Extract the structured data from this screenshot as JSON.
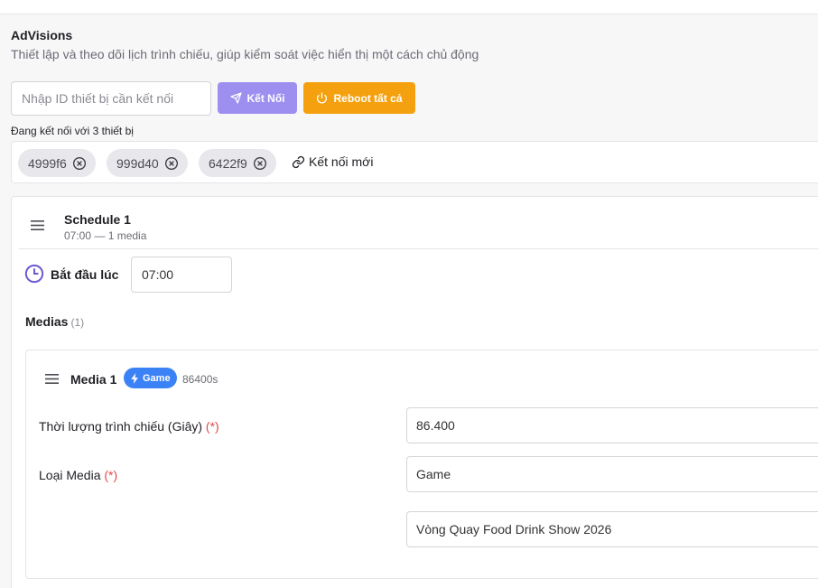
{
  "header": {
    "title": "AdVisions",
    "subtitle": "Thiết lập và theo dõi lịch trình chiếu, giúp kiểm soát việc hiển thị một cách chủ động"
  },
  "connect": {
    "placeholder": "Nhập ID thiết bị cần kết nối",
    "value": "",
    "connect_label": "Kết Nối",
    "reboot_label": "Reboot tất cả",
    "status": "Đang kết nối với 3 thiết bị",
    "devices": [
      "4999f6",
      "999d40",
      "6422f9"
    ],
    "new_connection_label": "Kết nối mới"
  },
  "schedule": {
    "title": "Schedule 1",
    "subtitle": "07:00 — 1 media",
    "start_label": "Bắt đầu lúc",
    "start_time": "07:00",
    "medias_label": "Medias",
    "medias_count": "(1)"
  },
  "media": {
    "title": "Media 1",
    "type_badge": "Game",
    "duration": "86400s",
    "duration_label": "Thời lượng trình chiếu (Giây)",
    "duration_value": "86.400",
    "type_label": "Loại Media",
    "type_value": "Game",
    "game_name": "Vòng Quay Food Drink Show 2026",
    "required_mark": "(*)"
  },
  "colors": {
    "connect_button": "#9d8ff0",
    "reboot_button": "#f5a10f",
    "badge": "#3b82f6",
    "clock_icon": "#6d5bd0",
    "required": "#e04848"
  },
  "icons": {
    "connect": "send-icon",
    "reboot": "power-icon",
    "remove_tag": "close-circle-icon",
    "new_connection": "link-icon",
    "drag": "drag-handle-icon",
    "start": "clock-icon",
    "game": "lightning-icon"
  }
}
